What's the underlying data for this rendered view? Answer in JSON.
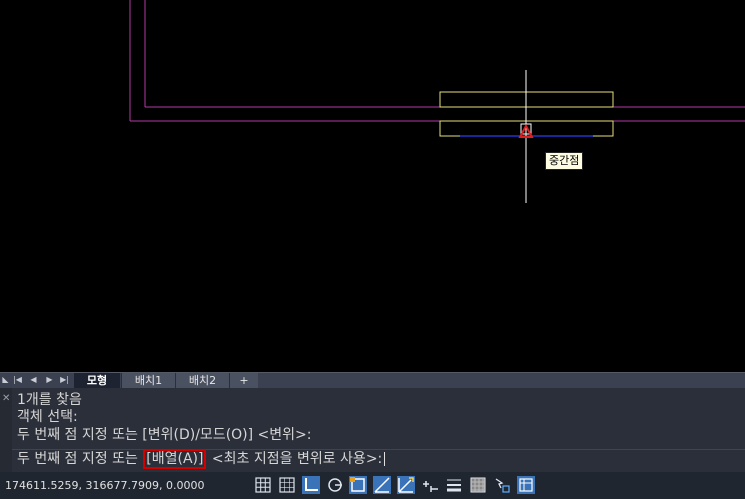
{
  "canvas": {
    "tooltip_text": "중간점",
    "colors": {
      "background": "#000000",
      "boundary": "#b23aa6",
      "rectangles": "#e6e07a",
      "line": "#2233cc",
      "crosshair": "#ffffff",
      "snap_marker": "#e02020"
    }
  },
  "layout_tabs": {
    "nav_icons": [
      "first-icon",
      "prev-icon",
      "next-icon",
      "last-icon"
    ],
    "tabs": [
      {
        "label": "모형",
        "active": true
      },
      {
        "label": "배치1",
        "active": false
      },
      {
        "label": "배치2",
        "active": false
      },
      {
        "label": "+",
        "active": false
      }
    ]
  },
  "command": {
    "history": [
      "1개를 찾음",
      "객체 선택:",
      "두 번째 점 지정 또는 [변위(D)/모드(O)] <변위>:"
    ],
    "prompt_prefix": "두 번째 점 지정 또는 ",
    "prompt_highlight": "[배열(A)]",
    "prompt_suffix": " <최초 지점을 변위로 사용>:"
  },
  "status_bar": {
    "coordinates": "174611.5259, 316677.7909, 0.0000",
    "buttons": [
      "grid-icon",
      "snap-icon",
      "ortho-icon",
      "polar-icon",
      "osnap-icon",
      "otrack-icon",
      "dynamic-ucs-icon",
      "dynamic-input-icon",
      "lineweight-icon",
      "transparency-icon",
      "selection-cycling-icon",
      "annotation-monitor-icon"
    ]
  }
}
